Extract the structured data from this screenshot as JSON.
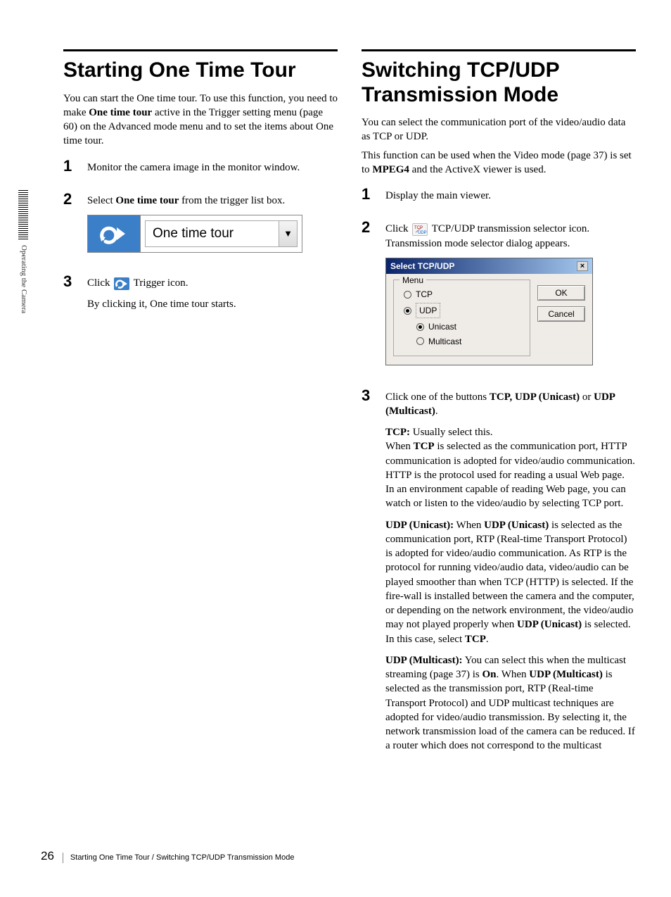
{
  "sidebar": {
    "label": "Operating the Camera"
  },
  "left": {
    "title": "Starting One Time Tour",
    "intro_pre": "You can start the One time tour.\nTo use this function, you need to make ",
    "intro_bold": "One time tour",
    "intro_post": " active in the Trigger setting menu (page 60) on the Advanced mode menu and to set the items about One time tour.",
    "step1": "Monitor the camera image in the monitor window.",
    "step2_pre": "Select ",
    "step2_bold": "One time tour",
    "step2_post": " from the trigger list box.",
    "ott_dropdown_text": "One time tour",
    "step3_line1": "Click ",
    "step3_line1_post": " Trigger icon.",
    "step3_line2": "By clicking it, One time tour starts."
  },
  "right": {
    "title": "Switching TCP/UDP Transmission Mode",
    "intro1": "You can select the communication port of the video/audio data as TCP or UDP.",
    "intro2_pre": "This function can be used when the Video mode (page 37) is set to ",
    "intro2_bold": "MPEG4",
    "intro2_post": " and the ActiveX viewer is used.",
    "step1": "Display the main viewer.",
    "step2_pre": "Click ",
    "step2_post": " TCP/UDP transmission selector icon. Transmission mode selector dialog appears.",
    "dialog": {
      "title": "Select TCP/UDP",
      "legend": "Menu",
      "opt_tcp": "TCP",
      "opt_udp": "UDP",
      "opt_unicast": "Unicast",
      "opt_multicast": "Multicast",
      "ok": "OK",
      "cancel": "Cancel"
    },
    "step3_pre": "Click one of the buttons ",
    "step3_bold1": "TCP, UDP (Unicast)",
    "step3_mid": " or ",
    "step3_bold2": "UDP (Multicast)",
    "step3_post": ".",
    "tcp_label": "TCP:",
    "tcp_l1": " Usually select this.",
    "tcp_p1_pre": "When ",
    "tcp_p1_bold": "TCP",
    "tcp_p1_post": " is selected as the communication port, HTTP communication is adopted for video/audio communication.",
    "tcp_p2": "HTTP is the protocol used for reading a usual Web page.",
    "tcp_p3": "In an environment capable of reading Web page, you can watch or listen to the video/audio by selecting  TCP port.",
    "udpu_label": "UDP (Unicast):",
    "udpu_pre": " When ",
    "udpu_bold1": "UDP (Unicast)",
    "udpu_mid": " is selected as the communication port, RTP (Real-time Transport Protocol) is adopted for video/audio communication. As RTP is the protocol for running video/audio data, video/audio can be played smoother than when TCP (HTTP) is selected. If the fire-wall is installed between the camera and the computer, or depending on the network environment, the video/audio may not played properly when ",
    "udpu_bold2": "UDP (Unicast)",
    "udpu_mid2": " is selected. In this case, select ",
    "udpu_bold3": "TCP",
    "udpu_post": ".",
    "udpm_label": "UDP (Multicast):",
    "udpm_pre": " You can select this when the multicast streaming (page 37) is ",
    "udpm_bold1": "On",
    "udpm_mid": ". When ",
    "udpm_bold2": "UDP (Multicast)",
    "udpm_post": " is selected as the transmission port, RTP (Real-time Transport Protocol) and UDP multicast techniques are adopted for video/audio transmission. By selecting it, the network transmission load of the camera can be reduced. If a router which does not correspond to the multicast"
  },
  "footer": {
    "page": "26",
    "text": "Starting One Time Tour / Switching TCP/UDP Transmission Mode"
  }
}
